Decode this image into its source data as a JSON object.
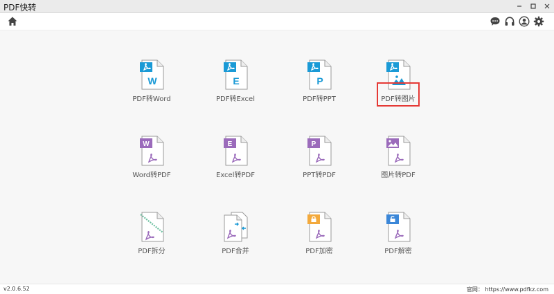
{
  "window": {
    "title": "PDF快转",
    "minimize_icon": "minimize-icon",
    "maximize_icon": "maximize-icon",
    "close_icon": "close-icon"
  },
  "toolbar": {
    "icons": [
      "home-icon",
      "chat-icon",
      "headset-icon",
      "user-icon",
      "gear-icon"
    ]
  },
  "tools": [
    {
      "label": "PDF转Word",
      "icon": "pdf-to-word-icon",
      "letter": "W",
      "accent": "#1a9ad6"
    },
    {
      "label": "PDF转Excel",
      "icon": "pdf-to-excel-icon",
      "letter": "E",
      "accent": "#1a9ad6"
    },
    {
      "label": "PDF转PPT",
      "icon": "pdf-to-ppt-icon",
      "letter": "P",
      "accent": "#1a9ad6"
    },
    {
      "label": "PDF转图片",
      "icon": "pdf-to-image-icon",
      "letter": "",
      "accent": "#1a9ad6",
      "selected": true
    },
    {
      "label": "Word转PDF",
      "icon": "word-to-pdf-icon",
      "letter": "W",
      "accent": "#9b6bbb"
    },
    {
      "label": "Excel转PDF",
      "icon": "excel-to-pdf-icon",
      "letter": "E",
      "accent": "#9b6bbb"
    },
    {
      "label": "PPT转PDF",
      "icon": "ppt-to-pdf-icon",
      "letter": "P",
      "accent": "#9b6bbb"
    },
    {
      "label": "图片转PDF",
      "icon": "image-to-pdf-icon",
      "letter": "",
      "accent": "#9b6bbb"
    },
    {
      "label": "PDF拆分",
      "icon": "pdf-split-icon",
      "letter": "",
      "accent": "#6cc0a0"
    },
    {
      "label": "PDF合并",
      "icon": "pdf-merge-icon",
      "letter": "",
      "accent": "#1a9ad6"
    },
    {
      "label": "PDF加密",
      "icon": "pdf-encrypt-icon",
      "letter": "",
      "accent": "#f3a93c"
    },
    {
      "label": "PDF解密",
      "icon": "pdf-decrypt-icon",
      "letter": "",
      "accent": "#3b87d8"
    }
  ],
  "footer": {
    "version": "v2.0.6.52",
    "website": "官网：  https://www.pdfkz.com"
  }
}
